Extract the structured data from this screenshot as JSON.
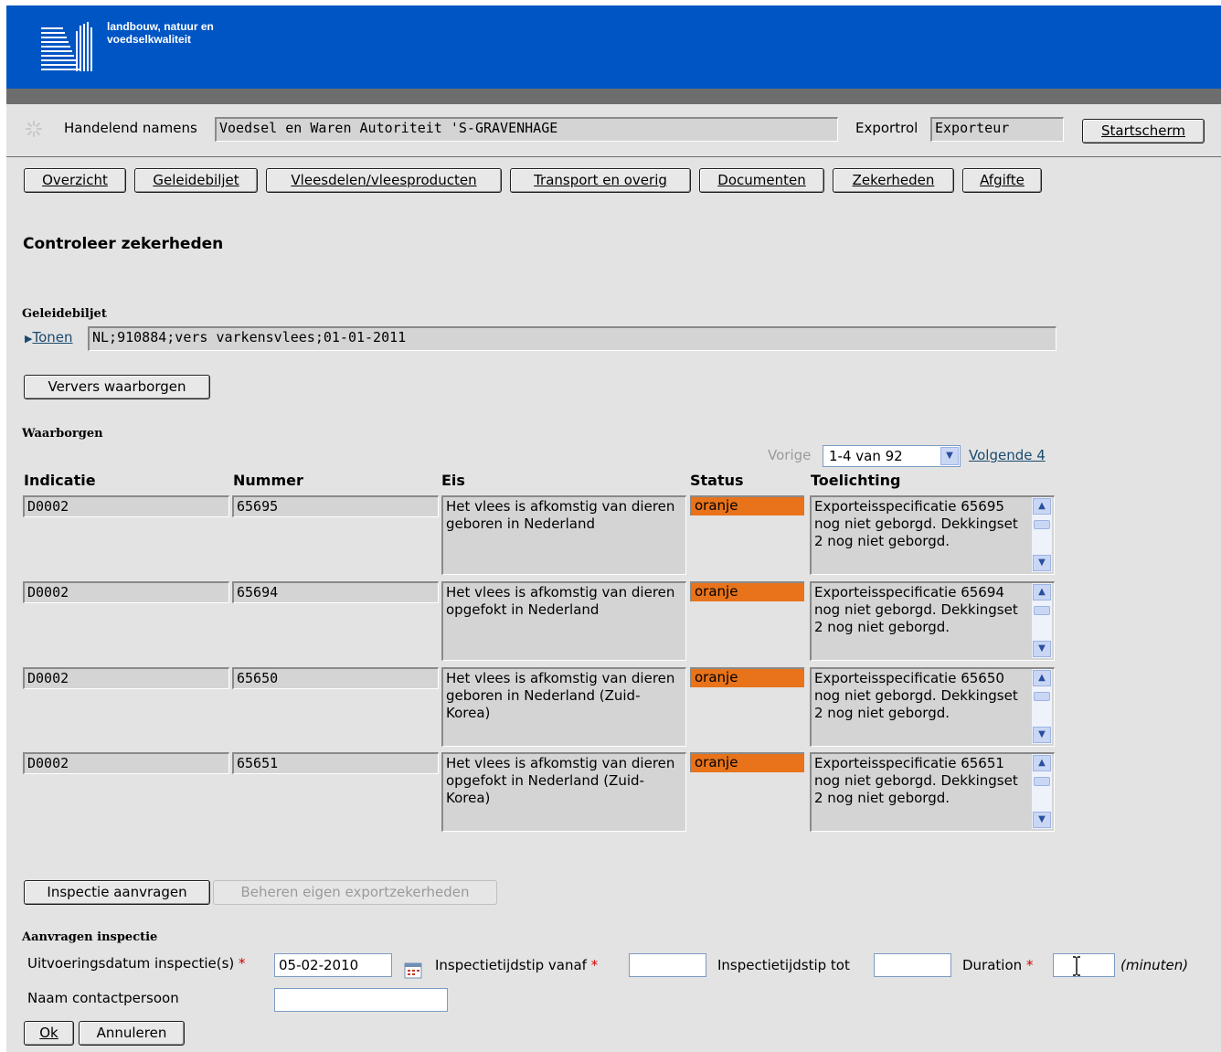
{
  "header": {
    "logo_line1": "landbouw, natuur en",
    "logo_line2": "voedselkwaliteit"
  },
  "context": {
    "acting_label": "Handelend namens",
    "acting_value": "Voedsel en Waren Autoriteit 'S-GRAVENHAGE",
    "exportrol_label": "Exportrol",
    "exportrol_value": "Exporteur",
    "start_button": "Startscherm"
  },
  "tabs": [
    "Overzicht",
    "Geleidebiljet",
    "Vleesdelen/vleesproducten",
    "Transport en overig",
    "Documenten",
    "Zekerheden",
    "Afgifte"
  ],
  "page_title": "Controleer zekerheden",
  "geleidebiljet": {
    "heading": "Geleidebiljet",
    "toggle": "Tonen",
    "value": "NL;910884;vers varkensvlees;01-01-2011"
  },
  "refresh_button": "Ververs waarborgen",
  "waarborgen": {
    "heading": "Waarborgen",
    "pager_prev": "Vorige",
    "pager_selected": "1-4 van 92",
    "pager_next": "Volgende 4",
    "columns": [
      "Indicatie",
      "Nummer",
      "Eis",
      "Status",
      "Toelichting"
    ],
    "rows": [
      {
        "indicatie": "D0002",
        "nummer": "65695",
        "eis": "Het vlees is afkomstig van dieren geboren in Nederland",
        "status": "oranje",
        "toelichting": "Exporteisspecificatie 65695 nog niet geborgd. Dekkingset 2 nog niet geborgd."
      },
      {
        "indicatie": "D0002",
        "nummer": "65694",
        "eis": "Het vlees is afkomstig van dieren opgefokt in Nederland",
        "status": "oranje",
        "toelichting": "Exporteisspecificatie 65694 nog niet geborgd. Dekkingset 2 nog niet geborgd."
      },
      {
        "indicatie": "D0002",
        "nummer": "65650",
        "eis": "Het vlees is afkomstig van dieren geboren in Nederland (Zuid-Korea)",
        "status": "oranje",
        "toelichting": "Exporteisspecificatie 65650 nog niet geborgd. Dekkingset 2 nog niet geborgd."
      },
      {
        "indicatie": "D0002",
        "nummer": "65651",
        "eis": "Het vlees is afkomstig van dieren opgefokt in Nederland (Zuid-Korea)",
        "status": "oranje",
        "toelichting": "Exporteisspecificatie 65651 nog niet geborgd. Dekkingset 2 nog niet geborgd."
      }
    ]
  },
  "actions": {
    "inspect": "Inspectie aanvragen",
    "manage": "Beheren eigen exportzekerheden"
  },
  "aanvragen": {
    "heading": "Aanvragen inspectie",
    "date_label": "Uitvoeringsdatum inspectie(s)",
    "date_value": "05-02-2010",
    "from_label": "Inspectietijdstip vanaf",
    "to_label": "Inspectietijdstip tot",
    "duration_label": "Duration",
    "minutes": "(minuten)",
    "contact_label": "Naam contactpersoon",
    "required": "*",
    "ok": "Ok",
    "cancel": "Annuleren"
  },
  "colors": {
    "banner": "#0055c4",
    "status_orange": "#e8731a",
    "background": "#e3e3e3"
  }
}
